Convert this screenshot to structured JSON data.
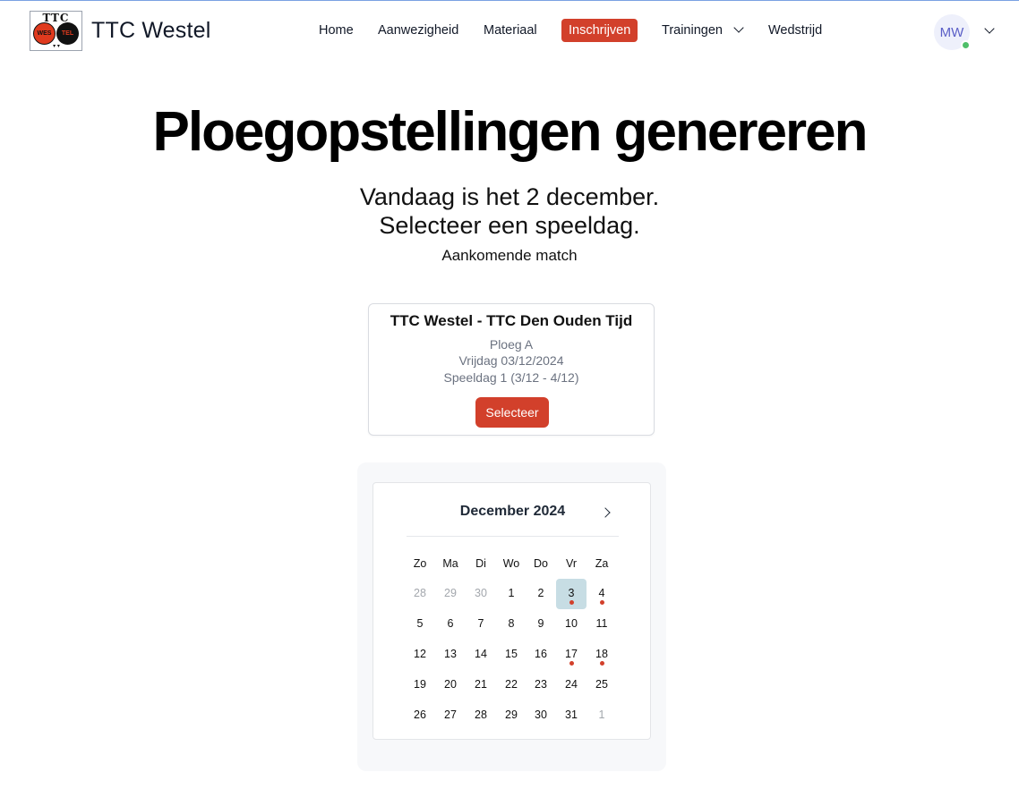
{
  "brand": {
    "name": "TTC Westel",
    "logo_text": "TTC",
    "logo_ball_left": "WES",
    "logo_ball_right": "TEL"
  },
  "nav": {
    "items": [
      {
        "label": "Home"
      },
      {
        "label": "Aanwezigheid"
      },
      {
        "label": "Materiaal"
      },
      {
        "label": "Inschrijven",
        "active": true
      },
      {
        "label": "Trainingen",
        "dropdown": true
      },
      {
        "label": "Wedstrijd"
      }
    ]
  },
  "user": {
    "initials": "MW",
    "status": "online"
  },
  "page": {
    "title": "Ploegopstellingen genereren",
    "subtitle_line1": "Vandaag is het 2 december.",
    "subtitle_line2": "Selecteer een speeldag.",
    "upcoming_label": "Aankomende match"
  },
  "match": {
    "title": "TTC Westel - TTC Den Ouden Tijd",
    "team": "Ploeg A",
    "date": "Vrijdag 03/12/2024",
    "matchday": "Speeldag 1 (3/12 - 4/12)",
    "button_label": "Selecteer"
  },
  "calendar": {
    "month_label": "December 2024",
    "weekdays": [
      "Zo",
      "Ma",
      "Di",
      "Wo",
      "Do",
      "Vr",
      "Za"
    ],
    "weeks": [
      [
        {
          "d": "28",
          "muted": true
        },
        {
          "d": "29",
          "muted": true
        },
        {
          "d": "30",
          "muted": true
        },
        {
          "d": "1"
        },
        {
          "d": "2"
        },
        {
          "d": "3",
          "selected": true,
          "dot": true
        },
        {
          "d": "4",
          "dot": true
        }
      ],
      [
        {
          "d": "5"
        },
        {
          "d": "6"
        },
        {
          "d": "7"
        },
        {
          "d": "8"
        },
        {
          "d": "9"
        },
        {
          "d": "10"
        },
        {
          "d": "11"
        }
      ],
      [
        {
          "d": "12"
        },
        {
          "d": "13"
        },
        {
          "d": "14"
        },
        {
          "d": "15"
        },
        {
          "d": "16"
        },
        {
          "d": "17",
          "dot": true
        },
        {
          "d": "18",
          "dot": true
        }
      ],
      [
        {
          "d": "19"
        },
        {
          "d": "20"
        },
        {
          "d": "21"
        },
        {
          "d": "22"
        },
        {
          "d": "23"
        },
        {
          "d": "24"
        },
        {
          "d": "25"
        }
      ],
      [
        {
          "d": "26"
        },
        {
          "d": "27"
        },
        {
          "d": "28"
        },
        {
          "d": "29"
        },
        {
          "d": "30"
        },
        {
          "d": "31"
        },
        {
          "d": "1",
          "muted": true
        }
      ]
    ]
  },
  "colors": {
    "accent": "#d2402b",
    "selected_day": "#c7dde4",
    "avatar_text": "#5b5fc7",
    "status_online": "#4fbf6a"
  }
}
